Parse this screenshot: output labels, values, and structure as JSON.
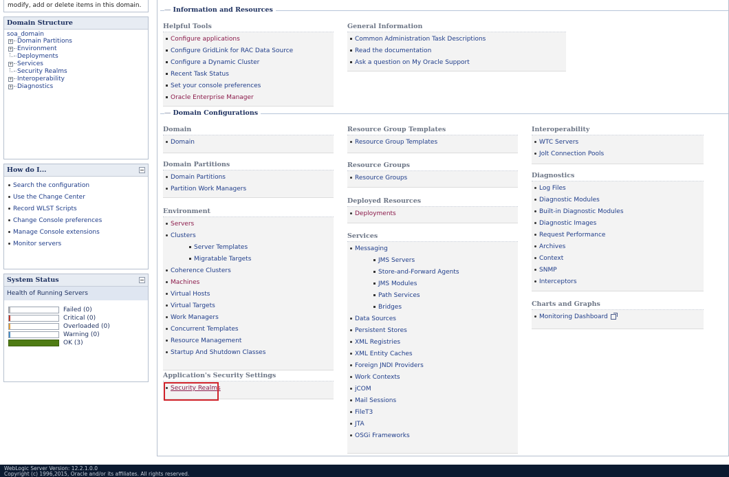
{
  "left": {
    "intro_text": "modify, add or delete items in this domain.",
    "domain_structure": {
      "title": "Domain Structure",
      "root": "soa_domain",
      "nodes": [
        {
          "label": "Domain Partitions",
          "expandable": true
        },
        {
          "label": "Environment",
          "expandable": true
        },
        {
          "label": "Deployments",
          "expandable": false
        },
        {
          "label": "Services",
          "expandable": true
        },
        {
          "label": "Security Realms",
          "expandable": false
        },
        {
          "label": "Interoperability",
          "expandable": true
        },
        {
          "label": "Diagnostics",
          "expandable": true
        }
      ]
    },
    "how_do_i": {
      "title": "How do I...",
      "items": [
        "Search the configuration",
        "Use the Change Center",
        "Record WLST Scripts",
        "Change Console preferences",
        "Manage Console extensions",
        "Monitor servers"
      ]
    },
    "system_status": {
      "title": "System Status",
      "subtitle": "Health of Running Servers",
      "rows": [
        {
          "label": "Failed (0)",
          "color": "#b0b0b0",
          "fill": 0
        },
        {
          "label": "Critical (0)",
          "color": "#c0392b",
          "fill": 0
        },
        {
          "label": "Overloaded (0)",
          "color": "#e0a040",
          "fill": 0
        },
        {
          "label": "Warning (0)",
          "color": "#4a90c8",
          "fill": 0
        },
        {
          "label": "OK (3)",
          "color": "#4f7c14",
          "fill": 1
        }
      ]
    }
  },
  "info_section": {
    "title": "Information and Resources",
    "helpful_tools": {
      "title": "Helpful Tools",
      "items": [
        "Configure applications",
        "Configure GridLink for RAC Data Source",
        "Configure a Dynamic Cluster",
        "Recent Task Status",
        "Set your console preferences",
        "Oracle Enterprise Manager"
      ]
    },
    "general_information": {
      "title": "General Information",
      "items": [
        "Common Administration Task Descriptions",
        "Read the documentation",
        "Ask a question on My Oracle Support"
      ]
    }
  },
  "domain_config": {
    "title": "Domain Configurations",
    "domain": {
      "title": "Domain",
      "items": [
        "Domain"
      ]
    },
    "domain_partitions": {
      "title": "Domain Partitions",
      "items": [
        "Domain Partitions",
        "Partition Work Managers"
      ]
    },
    "environment": {
      "title": "Environment",
      "items": [
        "Servers",
        "Clusters",
        "Server Templates",
        "Migratable Targets",
        "Coherence Clusters",
        "Machines",
        "Virtual Hosts",
        "Virtual Targets",
        "Work Managers",
        "Concurrent Templates",
        "Resource Management",
        "Startup And Shutdown Classes"
      ]
    },
    "app_security": {
      "title": "Application's Security Settings",
      "items": [
        "Security Realms"
      ]
    },
    "resource_group_templates": {
      "title": "Resource Group Templates",
      "items": [
        "Resource Group Templates"
      ]
    },
    "resource_groups": {
      "title": "Resource Groups",
      "items": [
        "Resource Groups"
      ]
    },
    "deployed_resources": {
      "title": "Deployed Resources",
      "items": [
        "Deployments"
      ]
    },
    "services": {
      "title": "Services",
      "items": [
        "Messaging",
        "JMS Servers",
        "Store-and-Forward Agents",
        "JMS Modules",
        "Path Services",
        "Bridges",
        "Data Sources",
        "Persistent Stores",
        "XML Registries",
        "XML Entity Caches",
        "Foreign JNDI Providers",
        "Work Contexts",
        "jCOM",
        "Mail Sessions",
        "FileT3",
        "JTA",
        "OSGi Frameworks"
      ]
    },
    "interoperability": {
      "title": "Interoperability",
      "items": [
        "WTC Servers",
        "Jolt Connection Pools"
      ]
    },
    "diagnostics": {
      "title": "Diagnostics",
      "items": [
        "Log Files",
        "Diagnostic Modules",
        "Built-in Diagnostic Modules",
        "Diagnostic Images",
        "Request Performance",
        "Archives",
        "Context",
        "SNMP",
        "Interceptors"
      ]
    },
    "charts_graphs": {
      "title": "Charts and Graphs",
      "items": [
        "Monitoring Dashboard"
      ]
    }
  },
  "footer": {
    "version": "WebLogic Server Version: 12.2.1.0.0",
    "copyright": "Copyright (c) 1996,2015, Oracle and/or its affiliates. All rights reserved."
  },
  "colors": {
    "link": "#1f3d8a",
    "visited": "#8b1a4a",
    "highlight": "#d0222a",
    "footer_bg": "#0b1a30"
  }
}
